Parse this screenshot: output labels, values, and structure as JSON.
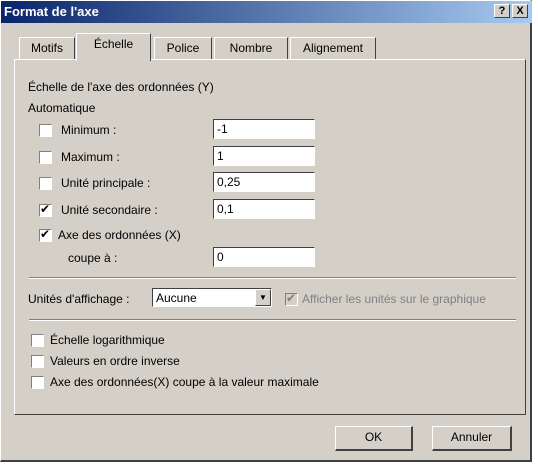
{
  "window": {
    "title": "Format de l'axe",
    "help_btn": "?",
    "close_btn": "X"
  },
  "tabs": [
    {
      "label": "Motifs",
      "active": false
    },
    {
      "label": "Échelle",
      "active": true
    },
    {
      "label": "Police",
      "active": false
    },
    {
      "label": "Nombre",
      "active": false
    },
    {
      "label": "Alignement",
      "active": false
    }
  ],
  "scale": {
    "heading": "Échelle de l'axe des ordonnées (Y)",
    "auto_label": "Automatique",
    "minimum": {
      "label": "Minimum :",
      "checked": false,
      "value": "-1"
    },
    "maximum": {
      "label": "Maximum :",
      "checked": false,
      "value": "1"
    },
    "major_unit": {
      "label": "Unité principale :",
      "checked": false,
      "value": "0,25"
    },
    "minor_unit": {
      "label": "Unité secondaire :",
      "checked": true,
      "value": "0,1"
    },
    "cross_axis": {
      "label": "Axe des ordonnées (X)",
      "checked": true
    },
    "crosses_at": {
      "label": "coupe à :",
      "value": "0"
    }
  },
  "display_units": {
    "label": "Unités d'affichage :",
    "selected": "Aucune",
    "show_label": "Afficher les unités sur le graphique",
    "show_checked": true
  },
  "options": [
    {
      "label": "Échelle logarithmique",
      "checked": false
    },
    {
      "label": "Valeurs en ordre inverse",
      "checked": false
    },
    {
      "label": "Axe des ordonnées(X) coupe à la valeur maximale",
      "checked": false
    }
  ],
  "buttons": {
    "ok": "OK",
    "cancel": "Annuler"
  }
}
